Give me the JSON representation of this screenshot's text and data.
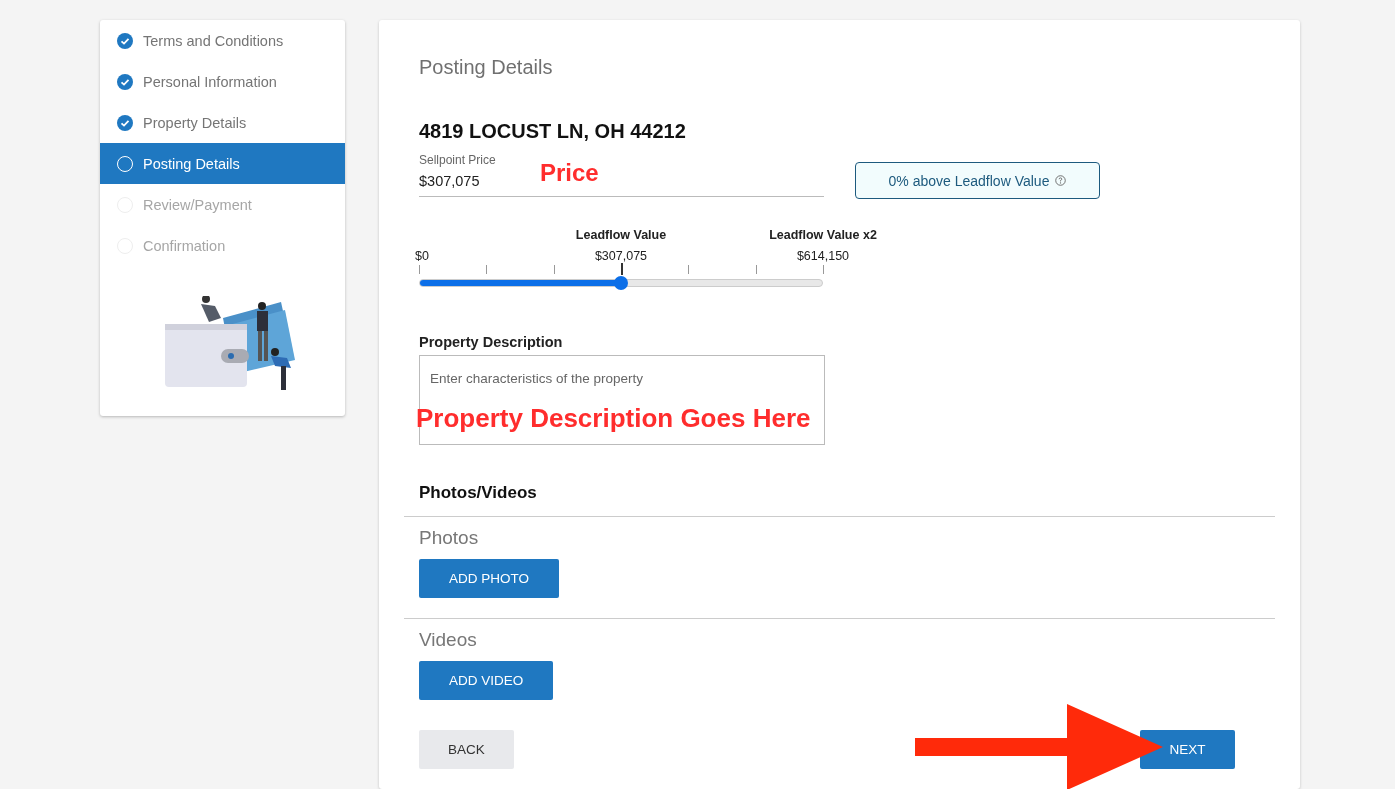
{
  "steps": [
    {
      "label": "Terms and Conditions",
      "completed": true,
      "disabled": false,
      "selected": false
    },
    {
      "label": "Personal Information",
      "completed": true,
      "disabled": false,
      "selected": false
    },
    {
      "label": "Property Details",
      "completed": true,
      "disabled": false,
      "selected": false
    },
    {
      "label": "Posting Details",
      "completed": false,
      "disabled": false,
      "selected": true
    },
    {
      "label": "Review/Payment",
      "completed": false,
      "disabled": true,
      "selected": false
    },
    {
      "label": "Confirmation",
      "completed": false,
      "disabled": true,
      "selected": false
    }
  ],
  "main": {
    "title": "Posting Details",
    "address": "4819 LOCUST LN, OH 44212",
    "price_field": {
      "label": "Sellpoint Price",
      "value": "$307,075",
      "annotation": "Price"
    },
    "comparison_badge": "0% above Leadflow Value",
    "slider": {
      "level": 0.5,
      "marks": [
        {
          "value": "$0"
        },
        {
          "caption": "Leadflow Value",
          "value": "$307,075"
        },
        {
          "caption": "Leadflow Value x2",
          "value": "$614,150"
        }
      ]
    },
    "description": {
      "label": "Property Description",
      "placeholder": "Enter characteristics of the property",
      "annotation": "Property Description Goes Here"
    },
    "media": {
      "heading": "Photos/Videos",
      "sections": [
        {
          "label": "Photos",
          "button": "ADD PHOTO"
        },
        {
          "label": "Videos",
          "button": "ADD VIDEO"
        }
      ]
    },
    "buttons": [
      {
        "label": "BACK",
        "kind": "secondary"
      },
      {
        "label": "NEXT",
        "kind": "primary"
      }
    ]
  }
}
